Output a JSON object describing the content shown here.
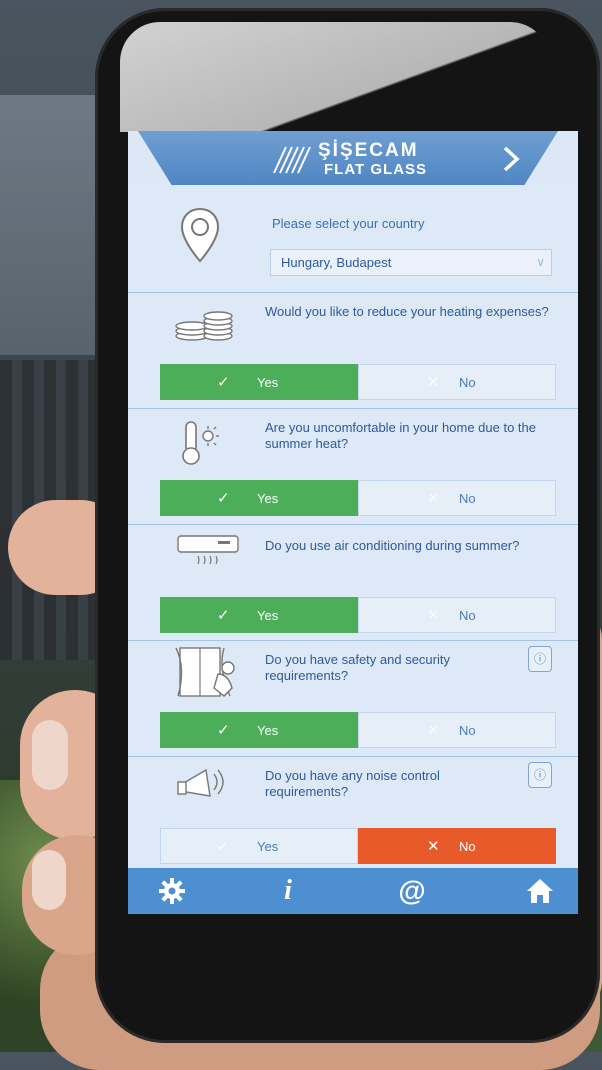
{
  "header": {
    "brand": "ŞİŞECAM",
    "brand_sub": "FLAT GLASS",
    "next_icon": "chevron-right-icon"
  },
  "country": {
    "label": "Please select your country",
    "selected": "Hungary, Budapest"
  },
  "questions": [
    {
      "id": "heating",
      "text": "Would you like to reduce your heating expenses?",
      "icon": "coins-icon",
      "answer": "Yes",
      "has_info": false
    },
    {
      "id": "summer",
      "text": "Are you uncomfortable in your home due to the summer heat?",
      "icon": "thermometer-sun-icon",
      "answer": "Yes",
      "has_info": false
    },
    {
      "id": "ac",
      "text": "Do you use air conditioning during summer?",
      "icon": "air-conditioner-icon",
      "answer": "Yes",
      "has_info": false
    },
    {
      "id": "security",
      "text": "Do you have safety and security requirements?",
      "icon": "burglar-window-icon",
      "answer": "Yes",
      "has_info": true
    },
    {
      "id": "noise",
      "text": "Do you have any noise control requirements?",
      "icon": "megaphone-icon",
      "answer": "No",
      "has_info": true
    }
  ],
  "options": {
    "yes": "Yes",
    "no": "No"
  },
  "info_badge": "ⓘ",
  "footer": {
    "settings_icon": "gear-icon",
    "info_label": "i",
    "email_label": "@",
    "home_icon": "home-icon"
  },
  "colors": {
    "yes_selected": "#4cae59",
    "no_selected": "#e85a2a",
    "footer": "#4d8fd1",
    "text": "#2d5a9b"
  }
}
